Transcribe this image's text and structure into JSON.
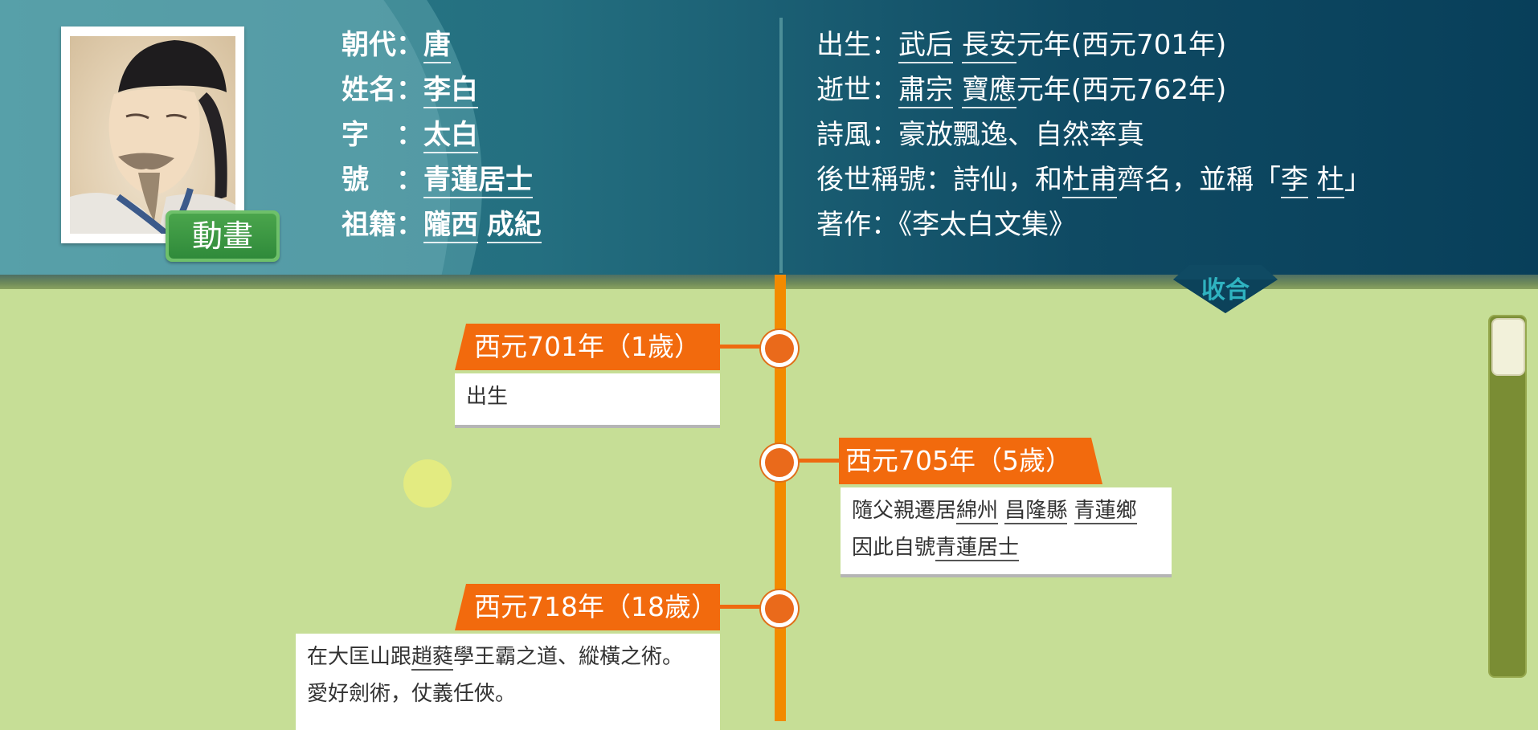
{
  "header": {
    "animation_button": "動畫",
    "left_info": [
      {
        "label": "朝代：",
        "value": "唐"
      },
      {
        "label": "姓名：",
        "value": "李白"
      },
      {
        "label": "字　：",
        "value": "太白"
      },
      {
        "label": "號　：",
        "value": "青蓮居士"
      },
      {
        "label": "祖籍：",
        "values": [
          "隴西",
          "成紀"
        ]
      }
    ],
    "right_info": {
      "birth": {
        "label": "出生：",
        "parts": [
          "武后",
          "長安",
          "元年(西元701年)"
        ]
      },
      "death": {
        "label": "逝世：",
        "parts": [
          "肅宗",
          "寶應",
          "元年(西元762年)"
        ]
      },
      "style": {
        "label": "詩風：",
        "text": "豪放飄逸、自然率真"
      },
      "title": {
        "label": "後世稱號：",
        "t1": "詩仙，和",
        "dufu": "杜甫",
        "t2": "齊名，並稱「",
        "li": "李",
        "du": "杜",
        "t3": "」"
      },
      "works": {
        "label": "著作：",
        "text": "《李太白文集》"
      }
    },
    "collapse_label": "收合"
  },
  "timeline": {
    "events": [
      {
        "year": "西元701年（1歲）",
        "desc": "出生"
      },
      {
        "year": "西元705年（5歲）",
        "desc_parts": [
          "隨父親遷居",
          "綿州",
          "昌隆縣",
          "青蓮鄉",
          "因此自號",
          "青蓮居士"
        ]
      },
      {
        "year": "西元718年（18歲）",
        "desc_parts": [
          "在大匡山跟",
          "趙蕤",
          "學王霸之道、縱橫之術。",
          "愛好劍術，仗義任俠。"
        ]
      }
    ]
  },
  "colors": {
    "header_dark": "#083f5a",
    "header_teal": "#2b7e88",
    "timeline_orange": "#f26a0d",
    "background_green": "#c6de96",
    "button_green": "#2f8a3a",
    "collapse_text": "#2fb3c0"
  }
}
